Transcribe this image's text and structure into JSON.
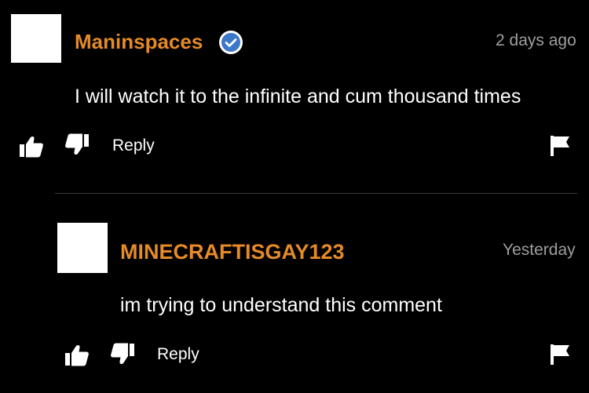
{
  "colors": {
    "background": "#000000",
    "username": "#e58a27",
    "timestamp": "#9e9e9e",
    "text": "#ffffff",
    "verified_badge": "#3c78c8",
    "divider": "#3a3a3a"
  },
  "comments": [
    {
      "username": "Maninspaces",
      "verified": true,
      "timestamp": "2 days ago",
      "text": "I will watch it to the infinite and cum thousand times",
      "reply_label": "Reply",
      "icons": [
        "thumbs-up-icon",
        "thumbs-down-icon",
        "flag-icon",
        "verified-badge-icon"
      ]
    },
    {
      "username": "MINECRAFTISGAY123",
      "verified": false,
      "timestamp": "Yesterday",
      "text": "im trying to understand this comment",
      "reply_label": "Reply",
      "icons": [
        "thumbs-up-icon",
        "thumbs-down-icon",
        "flag-icon"
      ]
    }
  ]
}
